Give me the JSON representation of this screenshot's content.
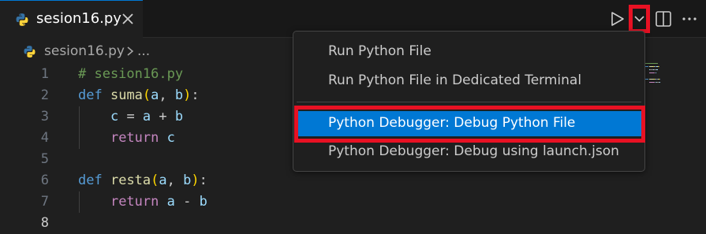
{
  "tab": {
    "file_name": "sesion16.py"
  },
  "breadcrumb": {
    "file_name": "sesion16.py",
    "overflow": "..."
  },
  "toolbar": {
    "icons": [
      "run-icon",
      "chevron-down-icon",
      "split-editor-icon",
      "more-actions-icon"
    ]
  },
  "editor": {
    "line_numbers": [
      "1",
      "2",
      "3",
      "4",
      "5",
      "6",
      "7",
      "8"
    ],
    "active_line": "8",
    "lines": [
      [
        {
          "t": "# sesion16.py",
          "c": "com"
        }
      ],
      [
        {
          "t": "def",
          "c": "kw"
        },
        {
          "t": " ",
          "c": "pun"
        },
        {
          "t": "suma",
          "c": "fn"
        },
        {
          "t": "(",
          "c": "br1"
        },
        {
          "t": "a",
          "c": "var"
        },
        {
          "t": ", ",
          "c": "pun"
        },
        {
          "t": "b",
          "c": "var"
        },
        {
          "t": ")",
          "c": "br1"
        },
        {
          "t": ":",
          "c": "pun"
        }
      ],
      [
        {
          "t": "    ",
          "c": "pun"
        },
        {
          "t": "c",
          "c": "var"
        },
        {
          "t": " = ",
          "c": "pun"
        },
        {
          "t": "a",
          "c": "var"
        },
        {
          "t": " + ",
          "c": "pun"
        },
        {
          "t": "b",
          "c": "var"
        }
      ],
      [
        {
          "t": "    ",
          "c": "pun"
        },
        {
          "t": "return",
          "c": "ctl"
        },
        {
          "t": " ",
          "c": "pun"
        },
        {
          "t": "c",
          "c": "var"
        }
      ],
      [],
      [
        {
          "t": "def",
          "c": "kw"
        },
        {
          "t": " ",
          "c": "pun"
        },
        {
          "t": "resta",
          "c": "fn"
        },
        {
          "t": "(",
          "c": "br1"
        },
        {
          "t": "a",
          "c": "var"
        },
        {
          "t": ", ",
          "c": "pun"
        },
        {
          "t": "b",
          "c": "var"
        },
        {
          "t": ")",
          "c": "br1"
        },
        {
          "t": ":",
          "c": "pun"
        }
      ],
      [
        {
          "t": "    ",
          "c": "pun"
        },
        {
          "t": "return",
          "c": "ctl"
        },
        {
          "t": " ",
          "c": "pun"
        },
        {
          "t": "a",
          "c": "var"
        },
        {
          "t": " - ",
          "c": "pun"
        },
        {
          "t": "b",
          "c": "var"
        }
      ],
      []
    ]
  },
  "menu": {
    "items": [
      {
        "label": "Run Python File"
      },
      {
        "label": "Run Python File in Dedicated Terminal"
      },
      {
        "label": "Python Debugger: Debug Python File"
      },
      {
        "label": "Python Debugger: Debug using launch.json"
      }
    ],
    "selected_label": "Python Debugger: Debug Python File"
  },
  "colors": {
    "accent": "#0078d4",
    "highlight_box": "#e81123",
    "python_blue": "#3572a5",
    "python_yellow": "#ffd43b"
  }
}
